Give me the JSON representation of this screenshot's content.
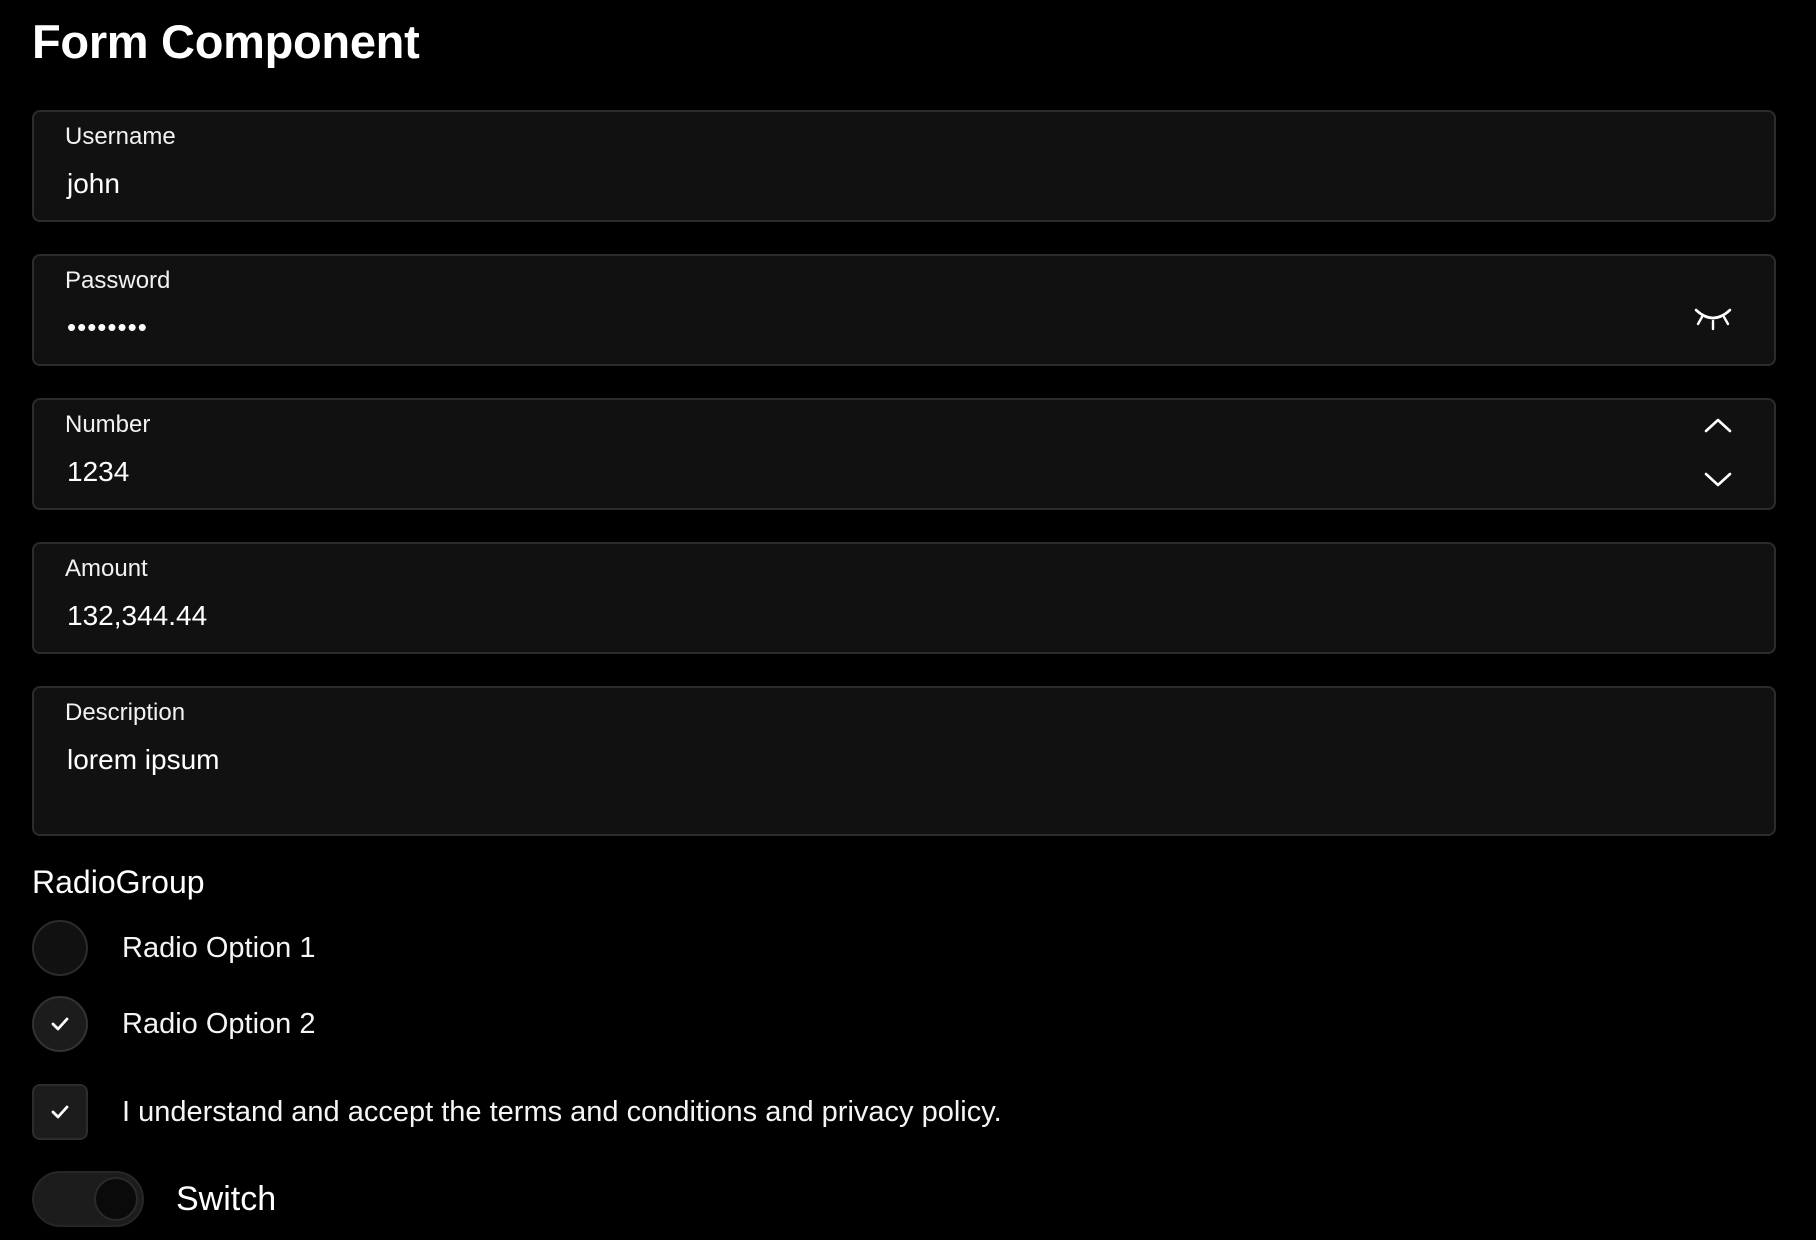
{
  "page": {
    "title": "Form Component"
  },
  "fields": {
    "username": {
      "label": "Username",
      "value": "john"
    },
    "password": {
      "label": "Password",
      "value": "••••••••",
      "toggle_icon": "eye-closed-icon"
    },
    "number": {
      "label": "Number",
      "value": "1234",
      "up_icon": "chevron-up-icon",
      "down_icon": "chevron-down-icon"
    },
    "amount": {
      "label": "Amount",
      "value": "132,344.44"
    },
    "description": {
      "label": "Description",
      "value": "lorem ipsum"
    }
  },
  "radio_group": {
    "label": "RadioGroup",
    "options": [
      {
        "label": "Radio Option 1",
        "checked": false
      },
      {
        "label": "Radio Option 2",
        "checked": true
      }
    ]
  },
  "terms": {
    "label": "I understand and accept the terms and conditions and privacy policy.",
    "checked": true
  },
  "switch": {
    "label": "Switch",
    "on": false
  },
  "colors": {
    "background": "#000000",
    "field_background": "#111111",
    "field_border": "#2c2c2c",
    "text": "#ffffff"
  }
}
